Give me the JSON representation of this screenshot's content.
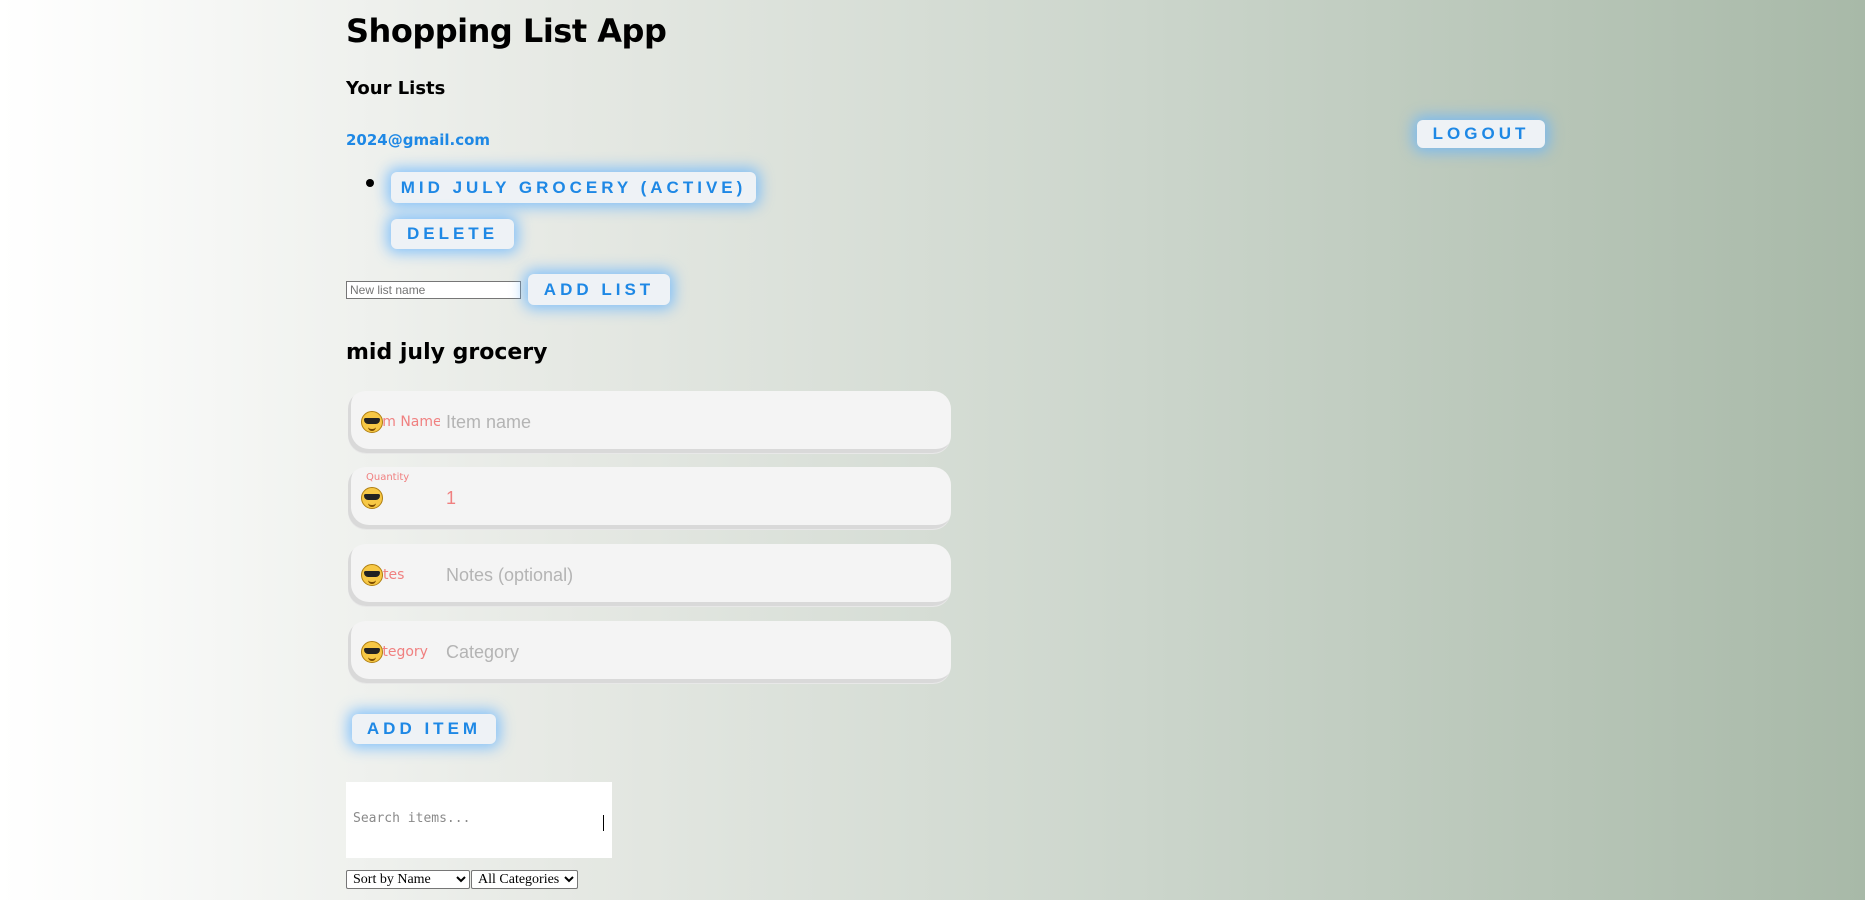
{
  "app": {
    "title": "Shopping List App",
    "lists_heading": "Your Lists",
    "user_email": "2024@gmail.com",
    "logout_label": "LOGOUT"
  },
  "lists": {
    "items": [
      {
        "label": "MID JULY GROCERY (ACTIVE)",
        "delete_label": "DELETE"
      }
    ],
    "new_list_placeholder": "New list name",
    "add_list_label": "ADD LIST"
  },
  "active_list": {
    "title": "mid july grocery",
    "fields": {
      "name": {
        "label": "Item Name",
        "placeholder": "Item name",
        "value": ""
      },
      "quantity": {
        "label": "Quantity",
        "value": "1"
      },
      "notes": {
        "label": "Notes",
        "placeholder": "Notes (optional)",
        "value": ""
      },
      "category": {
        "label": "Category",
        "placeholder": "Category",
        "value": ""
      }
    },
    "add_item_label": "ADD ITEM"
  },
  "filters": {
    "search_placeholder": "Search items...",
    "sort_selected": "Sort by Name",
    "category_selected": "All Categories"
  },
  "colors": {
    "accent": "#1e88e5",
    "label": "#f08080",
    "glow": "#64b4ff"
  },
  "icons": {
    "field_icon": "sunglasses-emoji-icon"
  }
}
